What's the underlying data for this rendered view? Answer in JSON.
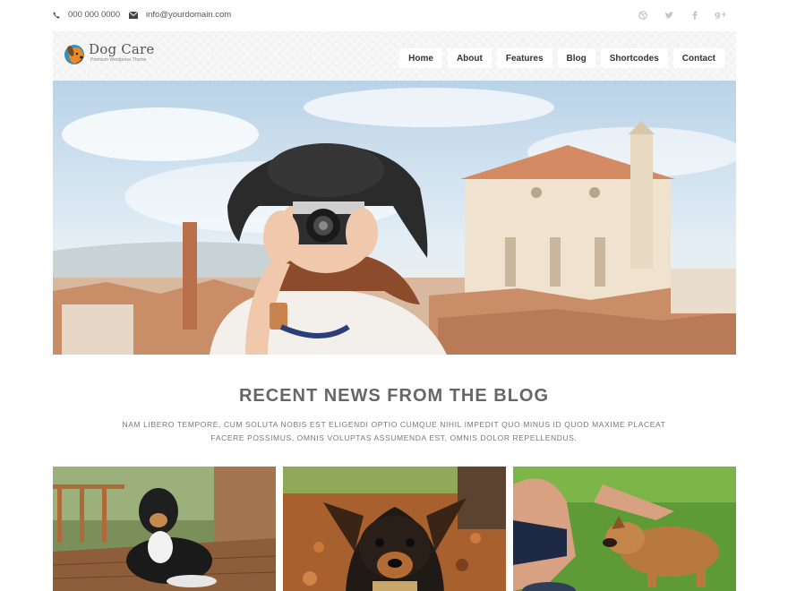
{
  "topbar": {
    "phone": "000 000 0000",
    "email": "info@yourdomain.com",
    "socials": [
      "dribbble-icon",
      "twitter-icon",
      "facebook-icon",
      "google-plus-icon"
    ]
  },
  "header": {
    "logo_title": "Dog Care",
    "logo_tagline": "Premium Wordpress Theme",
    "nav": [
      "Home",
      "About",
      "Features",
      "Blog",
      "Shortcodes",
      "Contact"
    ]
  },
  "blog": {
    "title": "RECENT NEWS FROM THE BLOG",
    "description": "NAM LIBERO TEMPORE, CUM SOLUTA NOBIS EST ELIGENDI OPTIO CUMQUE NIHIL IMPEDIT QUO MINUS ID QUOD MAXIME PLACEAT FACERE POSSIMUS, OMNIS VOLUPTAS ASSUMENDA EST, OMNIS DOLOR REPELLENDUS."
  },
  "colors": {
    "accent": "#e88a2a",
    "text": "#666666",
    "header_bg": "#f3f3f3"
  }
}
